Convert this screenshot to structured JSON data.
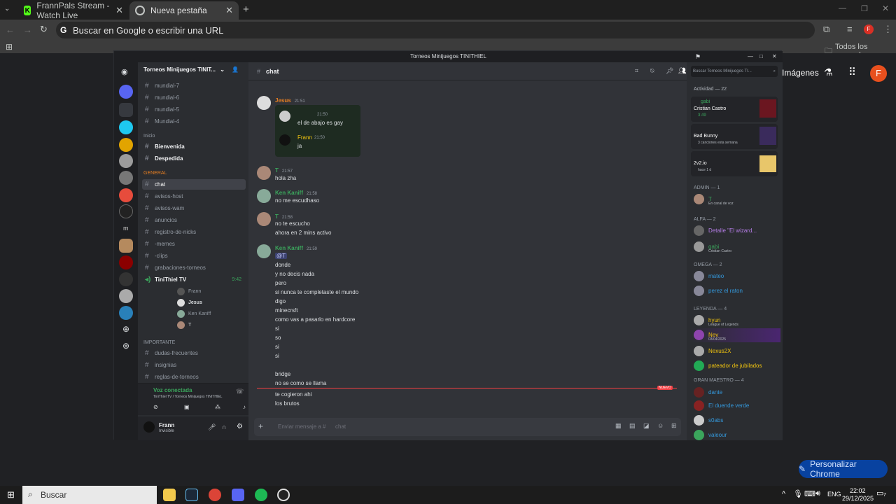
{
  "browser": {
    "tabs": [
      {
        "label": "FrannPals Stream - Watch Live"
      },
      {
        "label": "Nueva pestaña"
      }
    ],
    "omnibox_placeholder": "Buscar en Google o escribir una URL",
    "bookmarks_all": "Todos los marcadores",
    "ntp_images": "Imágenes",
    "profile_initial": "F",
    "customize": "Personalizar Chrome"
  },
  "discord": {
    "window_title": "Torneos Minijuegos TINITHIEL",
    "server_name": "Torneos Minijuegos TINIT...",
    "channels_top": [
      "mundial-7",
      "mundial-6",
      "mundial-5",
      "Mundial-4"
    ],
    "cat_inicio": "Inicio",
    "inicio_channels": [
      "Bienvenida",
      "Despedida"
    ],
    "cat_general": "GENERAL",
    "general_channels": [
      "chat",
      "avisos-host",
      "avisos-wam",
      "anuncios",
      "registro-de-nicks",
      "-memes",
      "-clips",
      "grabaciones-torneos"
    ],
    "voice_channel": "TiniThiel TV",
    "voice_time": "9:42",
    "voice_users": [
      "Frann",
      "Jesus",
      "Ken Kaniff",
      "T"
    ],
    "cat_importante": "IMPORTANTE",
    "importante_channels": [
      "dudas-frecuentes",
      "insignias",
      "reglas-de-torneos"
    ],
    "voice_status": "Voz conectada",
    "voice_location": "TiniThiel TV / Torneos Minijuegos TINITHIEL",
    "user_name": "Frann",
    "user_status": "Invisible",
    "current_channel": "chat",
    "search_placeholder": "Buscar Torneos Minijuegos TI...",
    "messages": [
      {
        "author": "Jesus",
        "time": "21:51",
        "lines": [],
        "color": "#e67e22"
      },
      {
        "author": "T",
        "time": "21:57",
        "lines": [
          "hola zha"
        ],
        "color": "#3ba55c"
      },
      {
        "author": "Ken Kaniff",
        "time": "21:58",
        "lines": [
          "no me escudhaso"
        ],
        "color": "#3ba55c"
      },
      {
        "author": "T",
        "time": "21:58",
        "lines": [
          "no te escucho",
          "ahora en 2 mins activo"
        ],
        "color": "#3ba55c"
      },
      {
        "author": "Ken Kaniff",
        "time": "21:59",
        "lines": [
          "@T",
          "donde",
          "y no decis nada",
          "pero",
          "si nunca te completaste el mundo",
          "digo",
          "minecrsft",
          "como vas a pasarlo en hardcore",
          "si",
          "so",
          "si",
          "si",
          "bridge",
          "no se como se llama"
        ],
        "color": "#3ba55c"
      },
      {
        "author": "",
        "time": "",
        "lines": [
          "te cogieron ahi",
          "los brutos"
        ],
        "color": "#3ba55c"
      }
    ],
    "embed": {
      "line1_time": "21:50",
      "line1": "el de abajo es gay",
      "author2": "Frann",
      "time2": "21:50",
      "line2": "ja"
    },
    "new_label": "NUEVO",
    "input_placeholder": "Enviar mensaje a #",
    "input_channel": "chat",
    "activity_header": "Actividad — 22",
    "activity": [
      {
        "name": "gabi",
        "detail": "Cristian Castro",
        "sub": "3:49"
      },
      {
        "name": "",
        "detail": "Bad Bunny",
        "sub": "3 canciones esta semana"
      },
      {
        "name": "",
        "detail": "2v2.io",
        "sub": "hace 1 d"
      }
    ],
    "groups": [
      {
        "label": "ADMIN",
        "count": "— 1",
        "members": [
          {
            "name": "T",
            "sub": "En canal de voz",
            "color": "#3ba55c"
          }
        ]
      },
      {
        "label": "ALFA",
        "count": "— 2",
        "members": [
          {
            "name": "Detalle \"El wizard...",
            "sub": "",
            "color": "#b67ee8"
          },
          {
            "name": "gabi",
            "sub": "Cristian Castro",
            "color": "#3ba55c"
          }
        ]
      },
      {
        "label": "OMEGA",
        "count": "— 2",
        "members": [
          {
            "name": "mateo",
            "sub": "",
            "color": "#3498db"
          },
          {
            "name": "perez el raton",
            "sub": "",
            "color": "#3498db"
          }
        ]
      },
      {
        "label": "LEYENDA",
        "count": "— 4",
        "members": [
          {
            "name": "hyun",
            "sub": "League of Legends",
            "color": "#f1c40f"
          },
          {
            "name": "Nev",
            "sub": "03/04/2025",
            "color": "#f1c40f"
          },
          {
            "name": "Nexus2X",
            "sub": "",
            "color": "#f1c40f"
          },
          {
            "name": "pateador de jubilados",
            "sub": "",
            "color": "#f1c40f"
          }
        ]
      },
      {
        "label": "GRAN MAESTRO",
        "count": "— 4",
        "members": [
          {
            "name": "dante",
            "sub": "",
            "color": "#e74c3c"
          },
          {
            "name": "El duende verde",
            "sub": "",
            "color": "#e74c3c"
          },
          {
            "name": "s0abs",
            "sub": "",
            "color": "#e74c3c"
          },
          {
            "name": "valeour",
            "sub": "",
            "color": "#e74c3c"
          }
        ]
      }
    ]
  },
  "taskbar": {
    "search": "Buscar",
    "lang": "ENG",
    "time": "22:02",
    "date": "29/12/2025",
    "notif": "7"
  }
}
